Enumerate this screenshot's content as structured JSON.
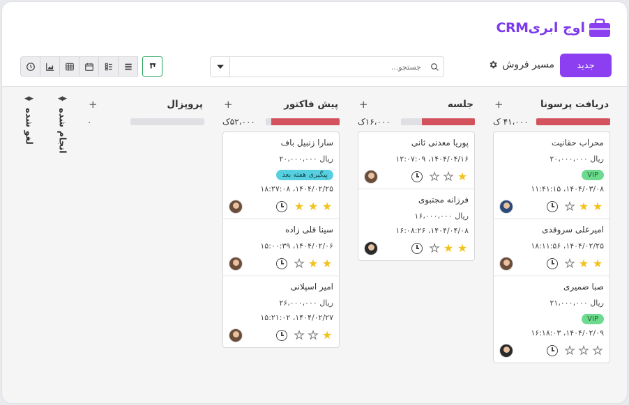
{
  "app": {
    "logo_text": "CRMاوج ابری",
    "new_button": "جدید",
    "pipeline_label": "مسیر فروش",
    "search_placeholder": "جستجو..."
  },
  "colors": {
    "accent": "#8b3ff0",
    "progress": "#d4515e",
    "vip": "#6ddb8e",
    "follow": "#56d0e0",
    "active_view": "#22a35a"
  },
  "view_icons": [
    "clock-icon",
    "area-chart-icon",
    "table-icon",
    "calendar-icon",
    "list-detail-icon",
    "list-icon",
    "kanban-icon"
  ],
  "columns": [
    {
      "title": "دریافت پرسونا",
      "total": "۴۱،۰۰۰ ک",
      "progress": 1.0,
      "cards": [
        {
          "name": "محراب حقانیت",
          "amount": "ریال ۲۰،۰۰۰،۰۰۰",
          "badge": "VIP",
          "badge_type": "vip",
          "date": "۱۴۰۴/۰۳/۰۸، ۱۱:۴۱:۱۵",
          "stars": 2,
          "avatar": "blue"
        },
        {
          "name": "امیرعلی سروقدی",
          "amount": "",
          "badge": "",
          "badge_type": "",
          "date": "۱۴۰۴/۰۲/۲۵، ۱۸:۱۱:۵۶",
          "stars": 2,
          "avatar": "brown"
        },
        {
          "name": "صبا ضمیری",
          "amount": "ریال ۲۱،۰۰۰،۰۰۰",
          "badge": "VIP",
          "badge_type": "vip",
          "date": "۱۴۰۴/۰۲/۰۹، ۱۶:۱۸:۰۳",
          "stars": 0,
          "avatar": "dark"
        }
      ]
    },
    {
      "title": "جلسه",
      "total": "۱۶،۰۰۰ک",
      "progress": 0.72,
      "cards": [
        {
          "name": "پوریا معدنی ثانی",
          "amount": "",
          "badge": "",
          "badge_type": "",
          "date": "۱۴۰۴/۰۴/۱۶، ۱۲:۰۷:۰۹",
          "stars": 1,
          "avatar": "brown"
        },
        {
          "name": "فرزانه مجتبوی",
          "amount": "ریال ۱۶،۰۰۰،۰۰۰",
          "badge": "",
          "badge_type": "",
          "date": "۱۴۰۴/۰۴/۰۸، ۱۶:۰۸:۲۶",
          "stars": 2,
          "avatar": "dark"
        }
      ]
    },
    {
      "title": "پیش فاکتور",
      "total": "۵۲،۰۰۰ک",
      "progress": 0.92,
      "cards": [
        {
          "name": "سارا زنبیل باف",
          "amount": "ریال ۲۰،۰۰۰،۰۰۰",
          "badge": "پیگیری هفته بعد",
          "badge_type": "follow",
          "date": "۱۴۰۴/۰۲/۲۵، ۱۸:۲۷:۰۸",
          "stars": 3,
          "avatar": "brown"
        },
        {
          "name": "سینا قلی زاده",
          "amount": "",
          "badge": "",
          "badge_type": "",
          "date": "۱۴۰۴/۰۲/۰۶، ۱۵:۰۰:۳۹",
          "stars": 2,
          "avatar": "brown"
        },
        {
          "name": "امیر اسپلانی",
          "amount": "ریال ۲۶،۰۰۰،۰۰۰",
          "badge": "",
          "badge_type": "",
          "date": "۱۴۰۴/۰۲/۲۷، ۱۵:۲۱:۰۲",
          "stars": 1,
          "avatar": "brown"
        }
      ]
    },
    {
      "title": "پروپزال",
      "total": "۰",
      "progress": 0,
      "cards": []
    }
  ],
  "collapsed_columns": [
    {
      "title": "انجام شده"
    },
    {
      "title": "لغو شده"
    }
  ]
}
